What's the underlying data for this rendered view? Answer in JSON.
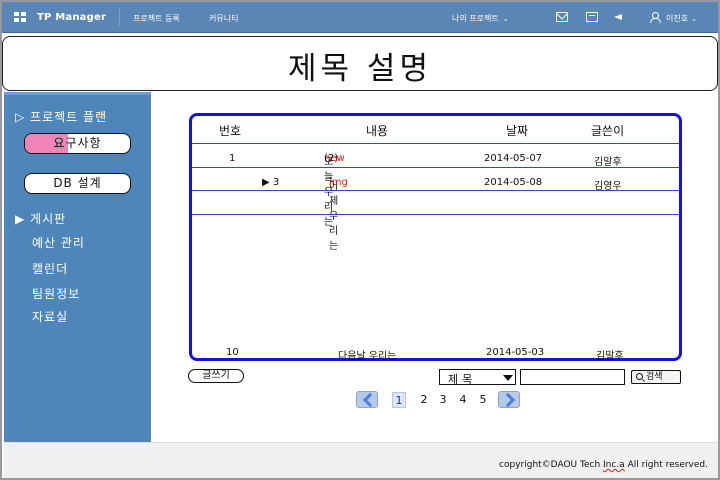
{
  "topbar": {
    "app_name": "TP Manager",
    "nav_register": "프로젝트 등록",
    "nav_community": "커뮤니티",
    "my_projects": "나의 프로젝트",
    "username": "이진호"
  },
  "title": "제목 설명",
  "sidebar": {
    "project_plan": "▷ 프로젝트 플랜",
    "requirements": "요구사항",
    "db_design": "DB 설계",
    "board": "▶ 게시판",
    "budget": "예산 관리",
    "calendar": "캘린더",
    "team_info": "팀원정보",
    "archive": "자료실"
  },
  "board": {
    "columns": [
      "번호",
      "내용",
      "날짜",
      "글쓴이"
    ],
    "rows": [
      {
        "no": "1",
        "content": "오늘 우리는",
        "tag": "new",
        "count": "(2)",
        "date": "2014-05-07",
        "author": "김말후"
      },
      {
        "no": "▶ 3",
        "content": "어제 우리는",
        "tag": "img",
        "count": "",
        "date": "2014-05-08",
        "author": "김영우"
      },
      {
        "no": "10",
        "content": "다음날 우리는",
        "tag": "",
        "count": "",
        "date": "2014-05-03",
        "author": "김말후"
      }
    ]
  },
  "controls": {
    "write": "글쓰기",
    "search_field": "제목",
    "search_value": "",
    "search_button": "검색"
  },
  "pager": {
    "pages": [
      "1",
      "2",
      "3",
      "4",
      "5"
    ],
    "current": "1"
  },
  "footer": {
    "copyright_prefix": "copyright©DAOU Tech ",
    "copyright_company": "Inc.a",
    "copyright_suffix": " All right reserved."
  },
  "colors": {
    "nav_bg": "#5a86b5",
    "sidebar_bg": "#4f86b9",
    "board_border": "#1414d8",
    "highlight_pink": "#ef84b6",
    "tag_red": "#e01818"
  }
}
